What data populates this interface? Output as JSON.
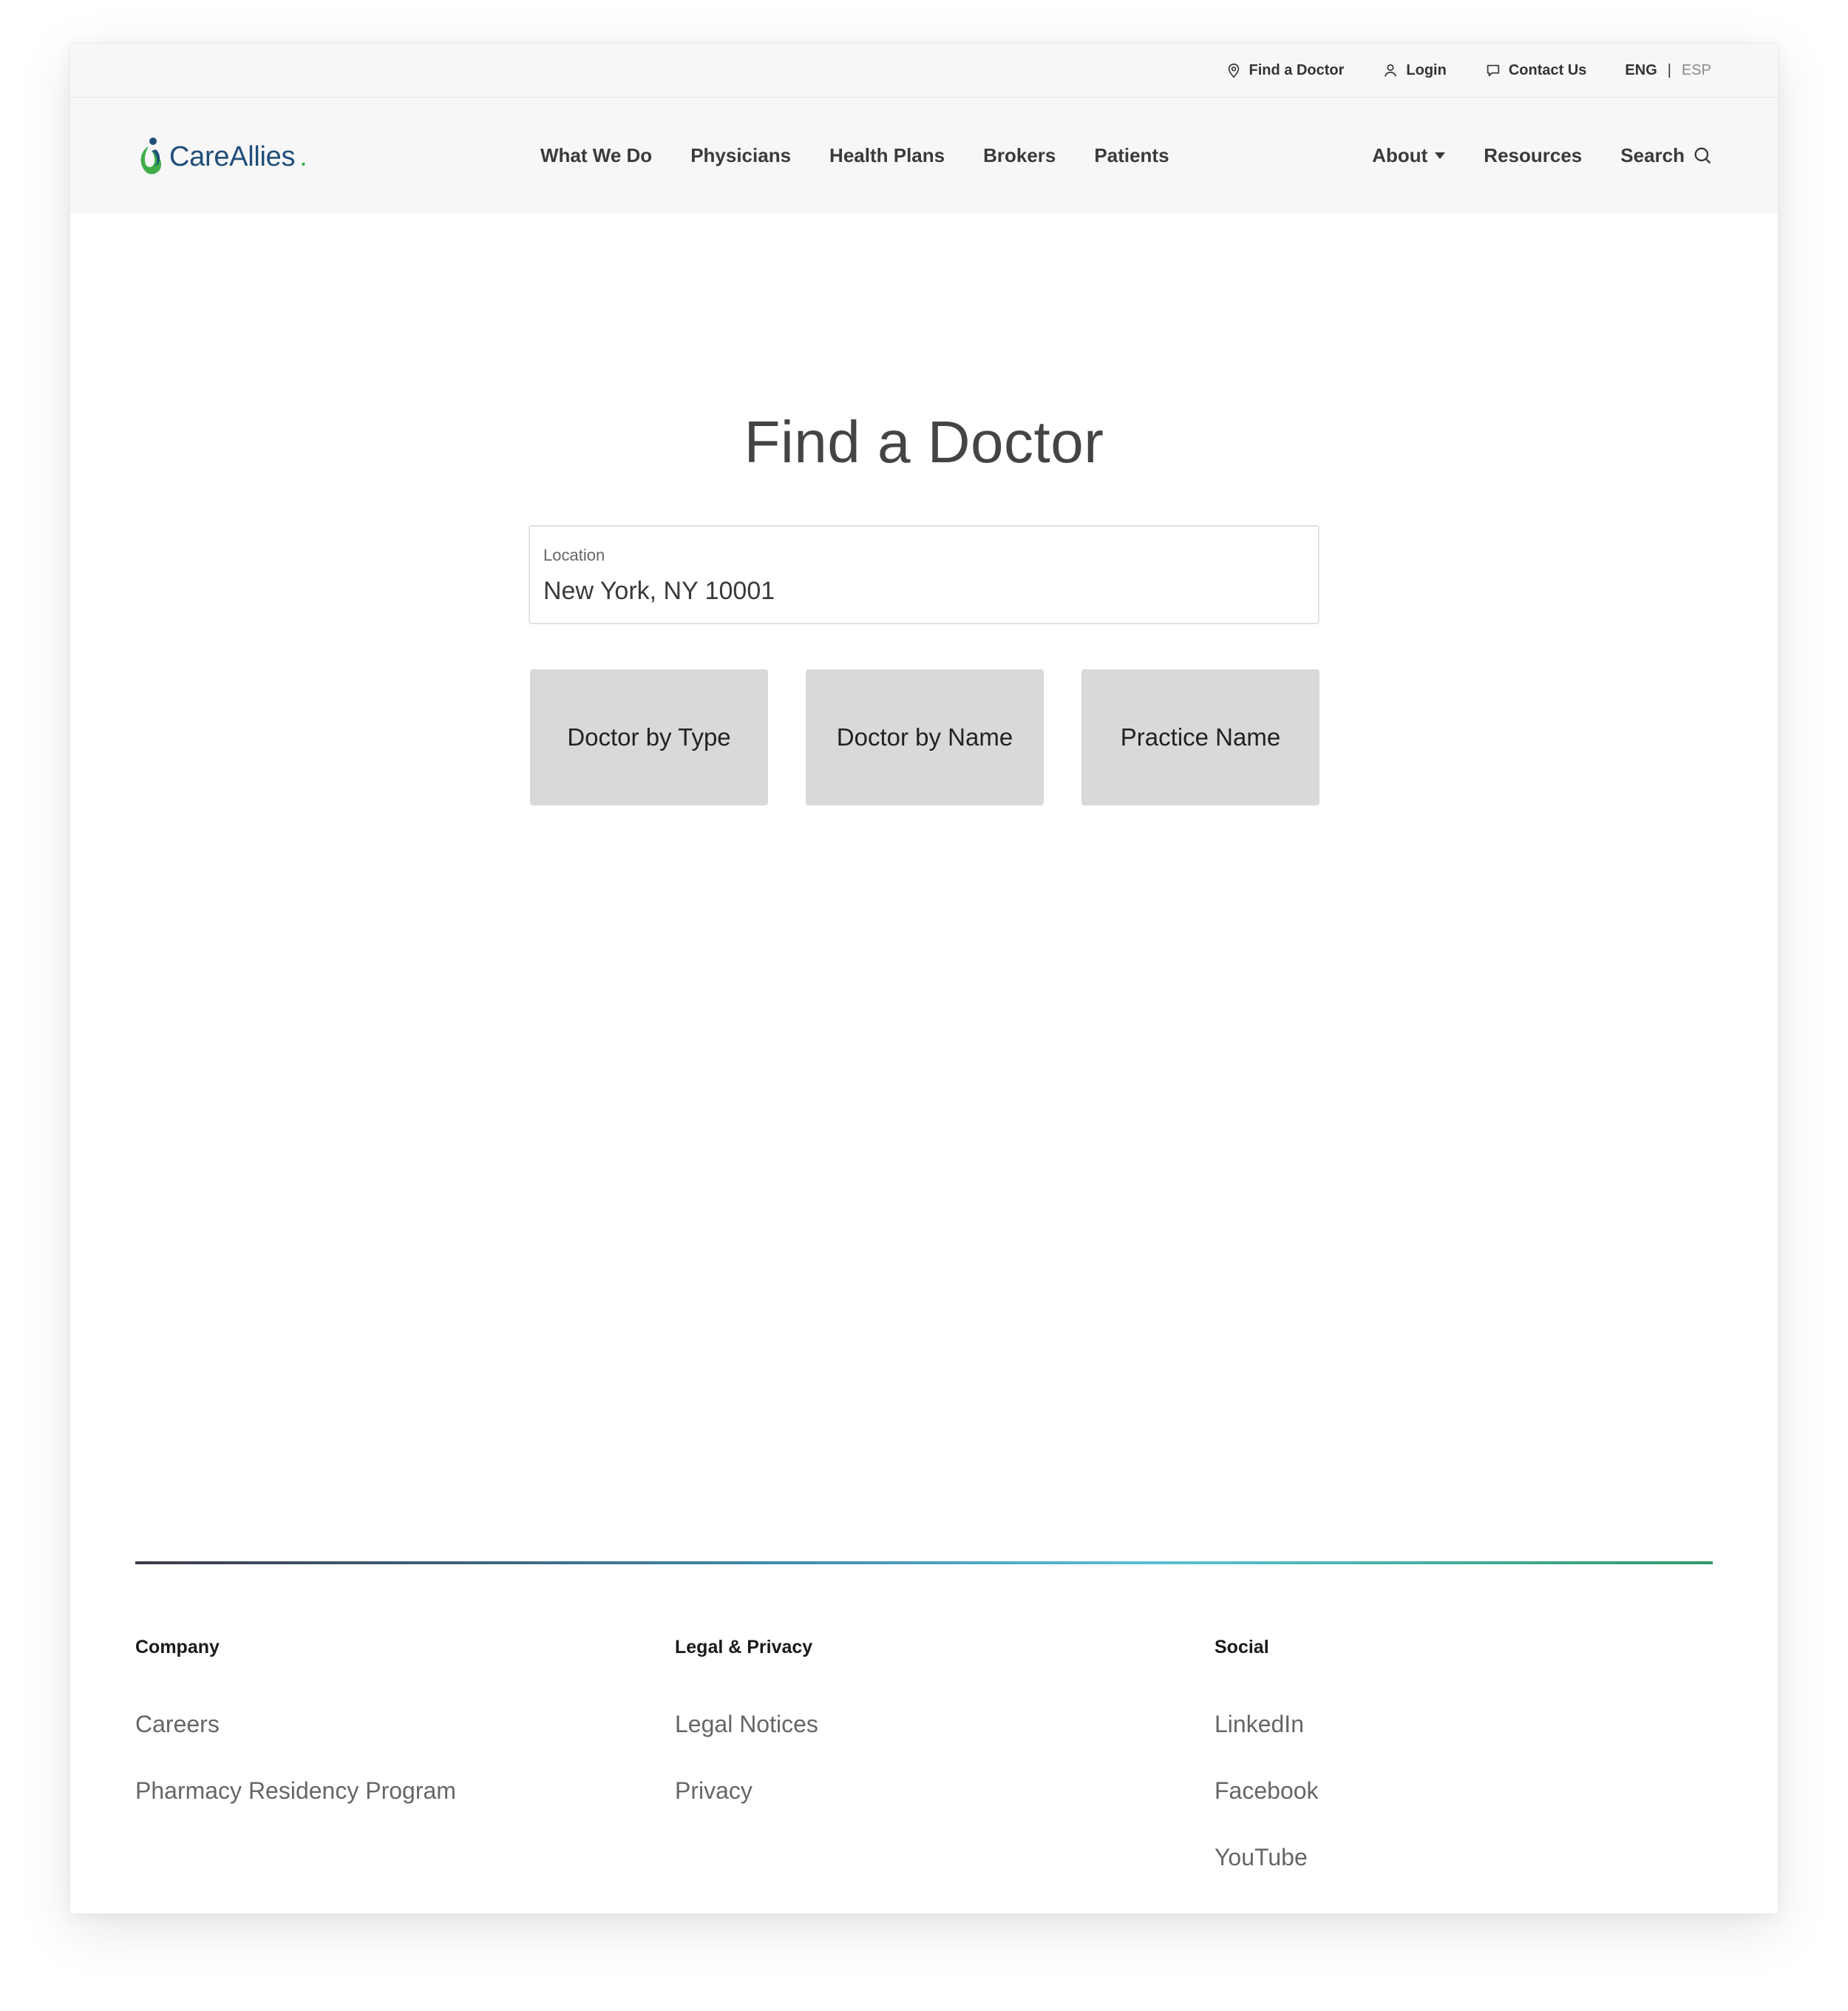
{
  "utility": {
    "find_doctor": "Find a Doctor",
    "login": "Login",
    "contact": "Contact Us",
    "lang_eng": "ENG",
    "lang_sep": "|",
    "lang_esp": "ESP"
  },
  "brand": {
    "name": "CareAllies",
    "dot": ".",
    "colors": {
      "blue": "#1f4e7a",
      "green": "#3fae49"
    }
  },
  "nav": {
    "center": [
      "What We Do",
      "Physicians",
      "Health Plans",
      "Brokers",
      "Patients"
    ],
    "about": "About",
    "resources": "Resources",
    "search": "Search"
  },
  "main": {
    "title": "Find a Doctor",
    "location_label": "Location",
    "location_value": "New York, NY 10001",
    "options": [
      "Doctor by Type",
      "Doctor by Name",
      "Practice Name"
    ]
  },
  "footer": {
    "company": {
      "heading": "Company",
      "links": [
        "Careers",
        "Pharmacy Residency Program"
      ]
    },
    "legal": {
      "heading": "Legal & Privacy",
      "links": [
        "Legal Notices",
        "Privacy"
      ]
    },
    "social": {
      "heading": "Social",
      "links": [
        "LinkedIn",
        "Facebook",
        "YouTube"
      ]
    }
  }
}
